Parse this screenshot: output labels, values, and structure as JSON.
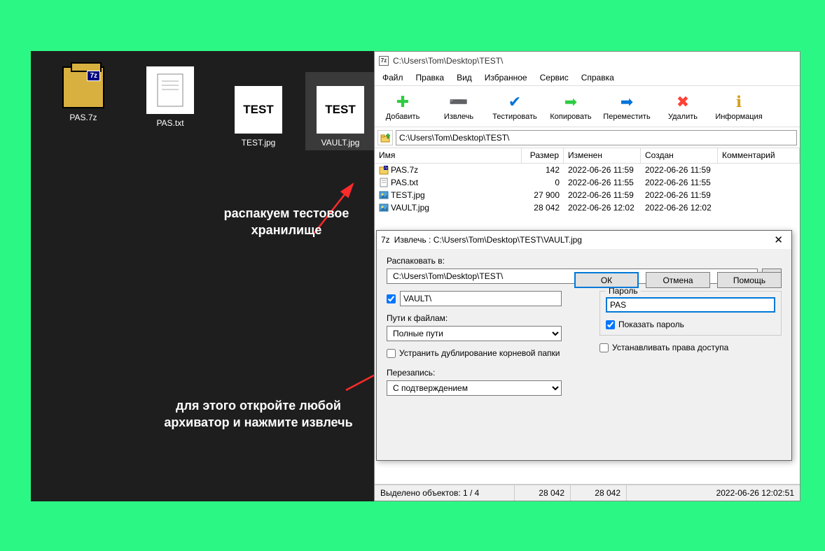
{
  "desktop": {
    "icons": [
      {
        "name": "PAS.7z",
        "type": "7z"
      },
      {
        "name": "PAS.txt",
        "type": "txt"
      },
      {
        "name": "TEST.jpg",
        "type": "jpg",
        "thumb": "TEST"
      },
      {
        "name": "VAULT.jpg",
        "type": "jpg",
        "thumb": "TEST",
        "selected": true
      }
    ]
  },
  "annotations": {
    "a1": "распакуем тестовое хранилище",
    "a2": "для этого откройте любой архиватор и нажмите извлечь"
  },
  "win7z": {
    "title": "C:\\Users\\Tom\\Desktop\\TEST\\",
    "menu": [
      "Файл",
      "Правка",
      "Вид",
      "Избранное",
      "Сервис",
      "Справка"
    ],
    "toolbar": [
      {
        "label": "Добавить",
        "glyph": "✚",
        "color": "#2ecc40"
      },
      {
        "label": "Извлечь",
        "glyph": "➖",
        "color": "#0074d9"
      },
      {
        "label": "Тестировать",
        "glyph": "✔",
        "color": "#0074d9"
      },
      {
        "label": "Копировать",
        "glyph": "➡",
        "color": "#2ecc40"
      },
      {
        "label": "Переместить",
        "glyph": "➡",
        "color": "#0074d9"
      },
      {
        "label": "Удалить",
        "glyph": "✖",
        "color": "#ff4136"
      },
      {
        "label": "Информация",
        "glyph": "ℹ",
        "color": "#d4a017"
      }
    ],
    "address": "C:\\Users\\Tom\\Desktop\\TEST\\",
    "columns": [
      "Имя",
      "Размер",
      "Изменен",
      "Создан",
      "Комментарий"
    ],
    "rows": [
      {
        "name": "PAS.7z",
        "size": "142",
        "mod": "2022-06-26 11:59",
        "crt": "2022-06-26 11:59",
        "icon": "7z"
      },
      {
        "name": "PAS.txt",
        "size": "0",
        "mod": "2022-06-26 11:55",
        "crt": "2022-06-26 11:55",
        "icon": "txt"
      },
      {
        "name": "TEST.jpg",
        "size": "27 900",
        "mod": "2022-06-26 11:59",
        "crt": "2022-06-26 11:59",
        "icon": "jpg"
      },
      {
        "name": "VAULT.jpg",
        "size": "28 042",
        "mod": "2022-06-26 12:02",
        "crt": "2022-06-26 12:02",
        "icon": "jpg"
      }
    ],
    "status": {
      "sel": "Выделено объектов: 1 / 4",
      "s1": "28 042",
      "s2": "28 042",
      "time": "2022-06-26 12:02:51"
    }
  },
  "dialog": {
    "title": "Извлечь : C:\\Users\\Tom\\Desktop\\TEST\\VAULT.jpg",
    "extract_to_label": "Распаковать в:",
    "extract_to": "C:\\Users\\Tom\\Desktop\\TEST\\",
    "subfolder": "VAULT\\",
    "paths_label": "Пути к файлам:",
    "paths_value": "Полные пути",
    "eliminate_dup": "Устранить дублирование корневой папки",
    "overwrite_label": "Перезапись:",
    "overwrite_value": "С подтверждением",
    "password_label": "Пароль",
    "password_value": "PAS",
    "show_password": "Показать пароль",
    "restore_perms": "Устанавливать права доступа",
    "ok": "ОК",
    "cancel": "Отмена",
    "help": "Помощь",
    "browse": "..."
  }
}
